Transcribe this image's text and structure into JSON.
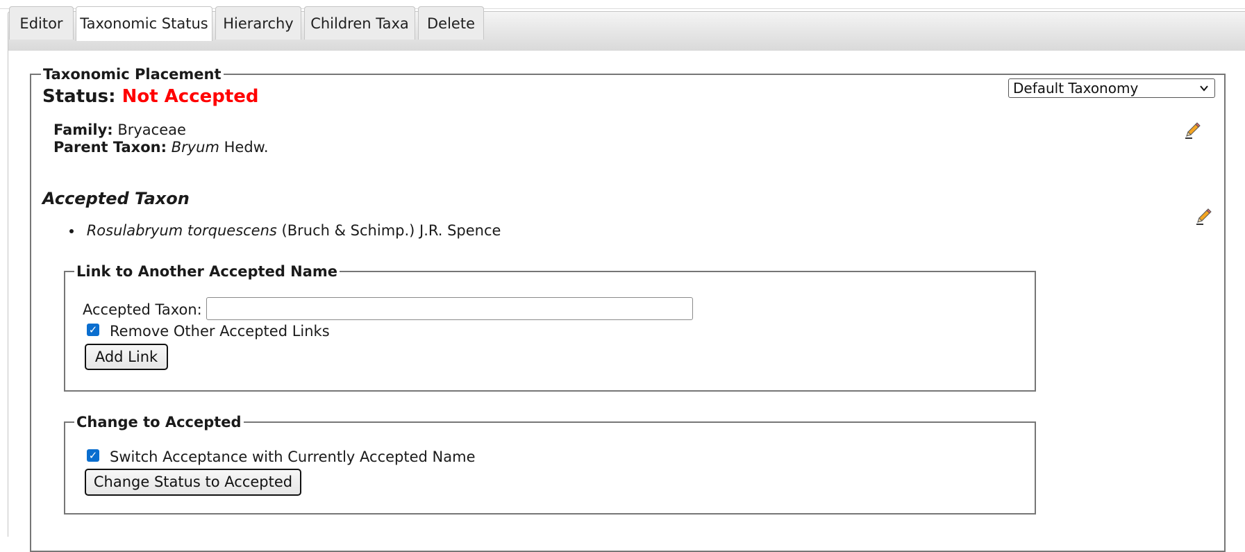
{
  "tabs": [
    {
      "label": "Editor"
    },
    {
      "label": "Taxonomic Status"
    },
    {
      "label": "Hierarchy"
    },
    {
      "label": "Children Taxa"
    },
    {
      "label": "Delete"
    }
  ],
  "active_tab": "Taxonomic Status",
  "placement": {
    "legend": "Taxonomic Placement",
    "status_label": "Status:",
    "status_value": "Not Accepted",
    "status_color": "#ff0000",
    "taxonomy_select": {
      "selected": "Default Taxonomy"
    },
    "family_label": "Family:",
    "family_value": "Bryaceae",
    "parent_label": "Parent Taxon:",
    "parent_genus": "Bryum",
    "parent_author": "Hedw.",
    "edit_icon": "pencil-icon"
  },
  "accepted": {
    "heading": "Accepted Taxon",
    "items": [
      {
        "name": "Rosulabryum torquescens",
        "author": "(Bruch & Schimp.) J.R. Spence"
      }
    ],
    "edit_icon": "pencil-icon"
  },
  "link_form": {
    "legend": "Link to Another Accepted Name",
    "field_label": "Accepted Taxon:",
    "field_value": "",
    "checkbox_label": "Remove Other Accepted Links",
    "checkbox_checked": true,
    "button_label": "Add Link"
  },
  "change_form": {
    "legend": "Change to Accepted",
    "checkbox_label": "Switch Acceptance with Currently Accepted Name",
    "checkbox_checked": true,
    "button_label": "Change Status to Accepted"
  }
}
